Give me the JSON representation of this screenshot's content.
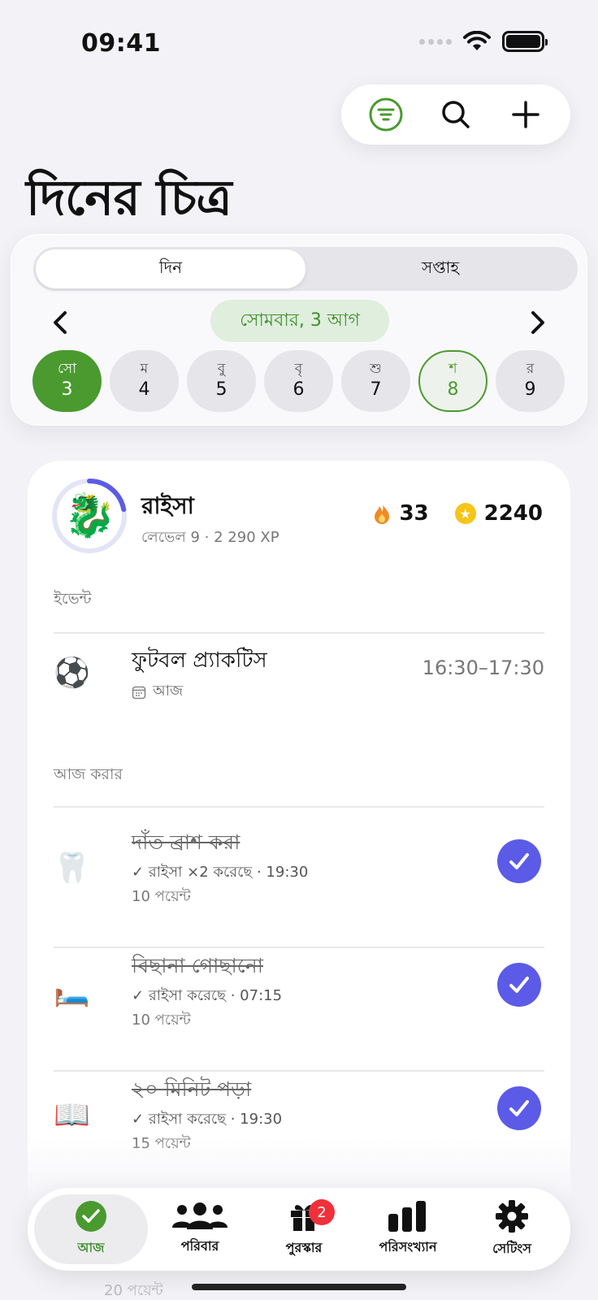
{
  "status": {
    "time": "09:41"
  },
  "title": "দিনের চিত্র",
  "segmented": {
    "day": "দিন",
    "week": "সপ্তাহ"
  },
  "date_label": "সোমবার, 3 আগ",
  "days": [
    {
      "name": "সো",
      "num": "3"
    },
    {
      "name": "ম",
      "num": "4"
    },
    {
      "name": "বু",
      "num": "5"
    },
    {
      "name": "বৃ",
      "num": "6"
    },
    {
      "name": "শু",
      "num": "7"
    },
    {
      "name": "শ",
      "num": "8"
    },
    {
      "name": "র",
      "num": "9"
    }
  ],
  "profile": {
    "name": "রাইসা",
    "level": "লেভেল 9 · 2 290 XP",
    "avatar": "🐉",
    "streak": "33",
    "coins": "2240",
    "level_progress": 0.22
  },
  "sections": {
    "events": "ইভেন্ট",
    "todo": "আজ করার"
  },
  "event": {
    "emoji": "⚽",
    "title": "ফুটবল প্র্যাকটিস",
    "sub": "আজ",
    "time": "16:30–17:30"
  },
  "tasks": [
    {
      "emoji": "🦷",
      "title": "দাঁত ব্রাশ করা",
      "meta": "রাইসা ×2 করেছে · 19:30",
      "points": "10 পয়েন্ট"
    },
    {
      "emoji": "🛏️",
      "title": "বিছানা গোছানো",
      "meta": "রাইসা করেছে · 07:15",
      "points": "10 পয়েন্ট"
    },
    {
      "emoji": "📖",
      "title": "২০ মিনিট পড়া",
      "meta": "রাইসা করেছে · 19:30",
      "points": "15 পয়েন্ট"
    }
  ],
  "partial_points": "20 পয়েন্ট",
  "tabs": [
    {
      "label": "আজ",
      "icon": "check-circle-icon"
    },
    {
      "label": "পরিবার",
      "icon": "people-icon"
    },
    {
      "label": "পুরস্কার",
      "icon": "gift-icon",
      "badge": "2"
    },
    {
      "label": "পরিসংখ্যান",
      "icon": "bar-chart-icon"
    },
    {
      "label": "সেটিংস",
      "icon": "gear-icon"
    }
  ],
  "colors": {
    "accent_green": "#4a9a2f",
    "accent_purple": "#5b5be8",
    "badge_red": "#f0303a"
  }
}
